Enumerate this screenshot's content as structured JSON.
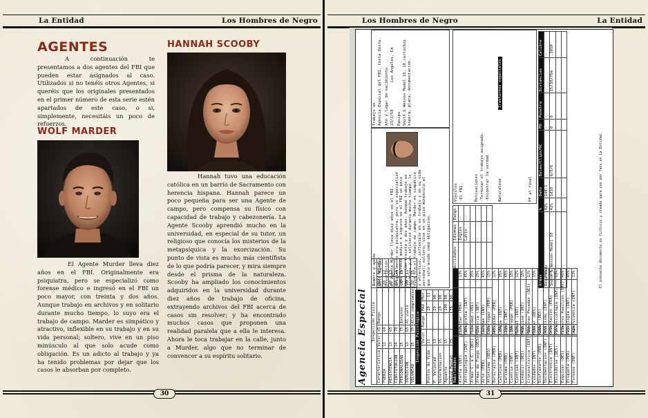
{
  "header": {
    "left_page_left": "La Entidad",
    "left_page_right": "Los Hombres de Negro",
    "right_page_left": "Los Hombres de Negro",
    "right_page_right": "La Entidad"
  },
  "page_numbers": {
    "left": "30",
    "right": "31"
  },
  "sections": {
    "agentes_title": "AGENTES",
    "agentes_text": "A continuación te presentamos a dos agentes del FBI que pueden estar asignados al caso. Utilizados si no tenéis otros Agentes, si queréis que los originales presentados en el primer número de esta serie estén apartados de este caso, o si, simplemente, necesitáis un poco de refuerzos.",
    "wolf_title": "WOLF MARDER",
    "wolf_text": "El Agente Murder lleva diez años en el FBI. Originalmente era psiquiatra, pero se especializó como forense médico e ingresó en el FBI un poco mayor, con treinta y dos años. Aunque trabajo en archivos y en solitario durante mucho tiempo, lo suyo era el trabajo de campo. Marder es simpático y atractivo, inflexible en su trabajo y en su vida personal; soltero, vive en un piso minúsculo al que solo acude como obligación. Es un adicto al trabajo y ya ha tenido problemas por dejar que los casos le absorban por completo.",
    "hannah_title": "HANNAH SCOOBY",
    "hannah_text": "Hannah tuvo una educación católica en un barrio de Sacramento con herencia hispana. Hannah parece un poco pequeña para ser una Agente de campo, pero compensa su físico con capacidad de trabajo y cabezonería. La Agente Scooby aprendió mucho en la universidad, en especial de su tutor, un religioso que conocía los misterios de la metapsíquica y la exorcización. Su punto de vista es mucho más científista de lo que podría parecer, y mira siempre desde el prisma de la naturaleza. Scooby ha ampliado los conocimientos adquiridos en la universidad durante diez años de trabajo de oficina, extrayendo archivos del FBI acerca de casos sin resolver; y ha encontrado muchos casos que proponen una realidad paralela que a ella le interesa. Ahora le toca trabajar en la calle, junto a Murder, algo que no terminar de convencer a su espíritu solitario."
  },
  "sheet": {
    "title": "Agencia Especial",
    "inspeccion_fisica": "Inspección Física",
    "caract_header": [
      "Característica",
      "Valor",
      "x5",
      "Rango",
      "MAX",
      "Actual"
    ],
    "caracteristicas": [
      [
        "FUERZA",
        "12",
        "60",
        "",
        "20",
        "12"
      ],
      [
        "RESISTENCIA",
        "13",
        "65",
        "",
        "20",
        "13"
      ],
      [
        "CONSTITUCIÓN",
        "14",
        "70",
        "",
        "20",
        "14"
      ],
      [
        "PERSONALIDAD",
        "15",
        "75",
        "Intenso",
        "20",
        "15"
      ],
      [
        "INTUICIÓN",
        "13",
        "65",
        "Al vuelo",
        "20",
        "13"
      ],
      [
        "VOLUNTAD",
        "15",
        "75",
        "Alto compromiso",
        "20",
        "15"
      ]
    ],
    "inspeccion_psicologica": "Inspección Psicológica",
    "psico_header": [
      "Valor",
      "Rango",
      "MAX",
      "Mín"
    ],
    "psico": [
      [
        "Puntos de Vida",
        "11",
        "",
        "20",
        "-11"
      ],
      [
        "P. Voluntad",
        "13",
        "",
        "20",
        "00"
      ],
      [
        "Determinación",
        "15",
        "",
        "20",
        "00"
      ],
      [
        "Aguante",
        "15",
        "",
        "100",
        "00"
      ],
      [
        "Salud Mental",
        "75",
        "",
        "75",
        "00"
      ]
    ],
    "habilidades_header": "Habilidades",
    "habilidades_a": [
      [
        "Alerta (INT)",
        "13%"
      ],
      [
        "Antropología (INT)",
        "35%"
      ],
      [
        "Armas C. a C. (DES)",
        "32%"
      ],
      [
        "Armas de Fuego (DES)",
        "35%"
      ],
      [
        "Arte (PER)",
        "12%"
      ],
      [
        "Atletismo (DES)",
        "16%"
      ],
      [
        "Burocracia (PER)",
        "45%"
      ],
      [
        "Callejeo (PER)",
        "15%"
      ],
      [
        "Carisma (PER)",
        "13%"
      ],
      [
        "Ciencia (INT)",
        "15%"
      ],
      [
        "Ciencias (INT)",
        "13%"
      ],
      [
        "Conducir (DES)",
        "45%"
      ],
      [
        "Criminalística (INT)",
        "55%"
      ],
      [
        "Cuidados (INT)",
        "15%"
      ],
      [
        "Disfrazarse (PER)",
        "15%"
      ],
      [
        "Documentación (INT)",
        "45%"
      ],
      [
        "Electrónica (INT)",
        "45%"
      ],
      [
        "Esconderse (DES)",
        "15%"
      ],
      [
        "Esquivar (DES)",
        "15%"
      ],
      [
        "Etiqueta (PER)",
        "15%"
      ],
      [
        "Forense (INT)",
        "42%"
      ]
    ],
    "habilidades_b": [
      [
        "Escuchar (PER)",
        "13%"
      ],
      [
        "Fotografía (INT)",
        "45%"
      ],
      [
        "Frialdad (VOL)",
        "35%"
      ],
      [
        "Historia (INT)",
        "25%"
      ],
      [
        "Idiomas (INT)",
        "45%"
      ],
      [
        "Interrogar (PER)",
        "15%"
      ],
      [
        "Intimidar (PER)",
        "12%"
      ],
      [
        "Lengua (INT)",
        "35%"
      ],
      [
        "Leyes (INT)",
        "45%"
      ],
      [
        "Liderazgo (PER)",
        "15%"
      ],
      [
        "Manual (INT)",
        "12%"
      ],
      [
        "Medicina (INT)",
        "15%"
      ],
      [
        "Máquinas Pesadas (DES)",
        "12%"
      ],
      [
        "Montar (DES)",
        "15%"
      ],
      [
        "Nadar (DES)",
        "12%"
      ],
      [
        "Ocultismo (INT)",
        "45%"
      ],
      [
        "Orientación (PER)",
        "15%"
      ],
      [
        "Parapsicología (INT)",
        "13%"
      ],
      [
        "Primeros Auxilios (INT)",
        "45%"
      ],
      [
        "Psicología (INT)",
        "45%"
      ],
      [
        "Supervivencia (INT)",
        "13%"
      ]
    ],
    "otras_habilidades": "Otras Habilidades",
    "idiomas": "Idiomas",
    "rango": "Rango",
    "idiomas_list": [
      [
        "Inglés",
        "--"
      ],
      [
        "Latín",
        "--"
      ]
    ],
    "descripcion_label": "Descripción",
    "descripcion": "El Agente Murder lleva diez años en el FBI. Originalmente era psiquiatra, pero se especializó como forense médico e ingresó en el FBI un poco mayor, con treinta y dos años. Aunque trabajo en archivos y en solitario durante mucho tiempo, lo suyo era el trabajo de campo. Marder es simpático y atractivo, inflexible en su trabajo y en su vida personal; soltero, vive en un piso minúsculo al que solo acude como obligación.",
    "nombre_label": "Nombre y apodo",
    "nombre": "Wolf Marder",
    "trabajo_label": "Trabajo en",
    "trabajo": "Agencia Especial del FBI, Costa Oeste.",
    "nacimiento_label": "Año y lugar de nacimiento",
    "nacimiento": "23/2/58",
    "lugar": "Los Ángeles, CA",
    "equipo_label": "Equipo",
    "equipo": "Smith & Wesson Model 10, 18 cartuchos espera, placa, documentación.",
    "vinculos": "Vínculos",
    "fbi": "-El FBI.",
    "ideales": "-Ideales",
    "motivaciones": "Motivaciones",
    "motiv_1": "-Terminar el trabajo asignado.",
    "motiv_2": "-Encontrar la verdad.",
    "naturaleza_label": "Naturaleza",
    "naturaleza": "Especiales",
    "trastornos": "Trastornos especiales",
    "armas_header": [
      "Armas",
      "%",
      "Daño",
      "Balas/Clips/RC",
      "PD",
      "Penetra",
      "Distancias",
      "Calibre"
    ],
    "armas": [
      [
        "Desarmado",
        "42%",
        "1d4-1",
        "-",
        "-",
        "-",
        "-",
        "-"
      ],
      [
        "Smith & Wesson Model 10",
        "42%",
        "1d10",
        "6/6/6",
        "0",
        "0",
        "15/30/75m",
        ".38SP"
      ]
    ],
    "footnote": "El presente documento es ficticio y creado para uso por fans en La Entidad.",
    "pf": "PF al final"
  }
}
